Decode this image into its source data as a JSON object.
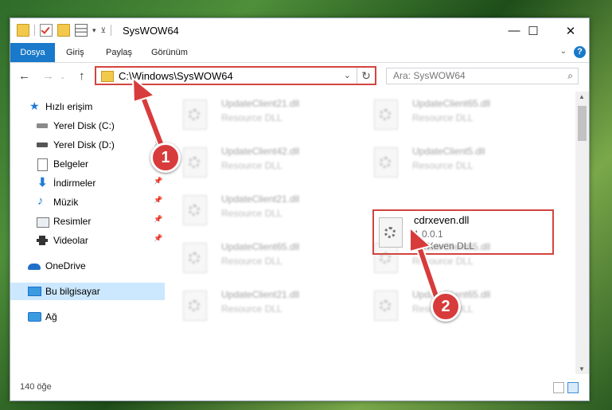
{
  "window": {
    "title": "SysWOW64"
  },
  "controls": {
    "minimize": "—",
    "maximize": "☐",
    "close": "✕"
  },
  "ribbon": {
    "tabs": [
      "Dosya",
      "Giriş",
      "Paylaş",
      "Görünüm"
    ],
    "help": "?"
  },
  "nav": {
    "back": "←",
    "forward": "→",
    "up": "↑",
    "address": "C:\\Windows\\SysWOW64",
    "refresh": "↻",
    "dropdown": "⌄"
  },
  "search": {
    "placeholder": "Ara: SysWOW64",
    "icon": "search-icon"
  },
  "sidebar": {
    "items": [
      {
        "label": "Hızlı erişim",
        "icon": "star-icon"
      },
      {
        "label": "Yerel Disk (C:)",
        "icon": "drive-icon"
      },
      {
        "label": "Yerel Disk (D:)",
        "icon": "drive-icon"
      },
      {
        "label": "Belgeler",
        "icon": "documents-icon"
      },
      {
        "label": "İndirmeler",
        "icon": "download-icon"
      },
      {
        "label": "Müzik",
        "icon": "music-icon"
      },
      {
        "label": "Resimler",
        "icon": "pictures-icon"
      },
      {
        "label": "Videolar",
        "icon": "video-icon"
      },
      {
        "label": "OneDrive",
        "icon": "cloud-icon"
      },
      {
        "label": "Bu bilgisayar",
        "icon": "computer-icon"
      },
      {
        "label": "Ağ",
        "icon": "network-icon"
      }
    ]
  },
  "files": [
    {
      "name": "UpdateClient21.dll",
      "desc": "Resource DLL"
    },
    {
      "name": "UpdateClient65.dll",
      "desc": "Resource DLL"
    },
    {
      "name": "UpdateClient42.dll",
      "desc": "Resource DLL"
    },
    {
      "name": "UpdateClient5.dll",
      "desc": "Resource DLL"
    },
    {
      "name": "UpdateClient21.dll",
      "desc": "Resource DLL"
    },
    {
      "name": "UpdateClient65.dll",
      "desc": "Resource DLL"
    },
    {
      "name": "UpdateClient65.dll",
      "desc": "Resource DLL"
    },
    {
      "name": "UpdateClient21.dll",
      "desc": "Resource DLL"
    },
    {
      "name": "UpdateClient65.dll",
      "desc": "Resource DLL"
    }
  ],
  "target_file": {
    "name": "cdrxeven.dll",
    "version": "1.0.0.1",
    "desc": "cdrXeven DLL"
  },
  "status": {
    "count": "140 öğe"
  },
  "annotations": {
    "badge1": "1",
    "badge2": "2",
    "highlight_color": "#d24440",
    "badge_color": "#d83b3b"
  },
  "colors": {
    "accent": "#1979ca",
    "selection": "#cce8ff"
  }
}
